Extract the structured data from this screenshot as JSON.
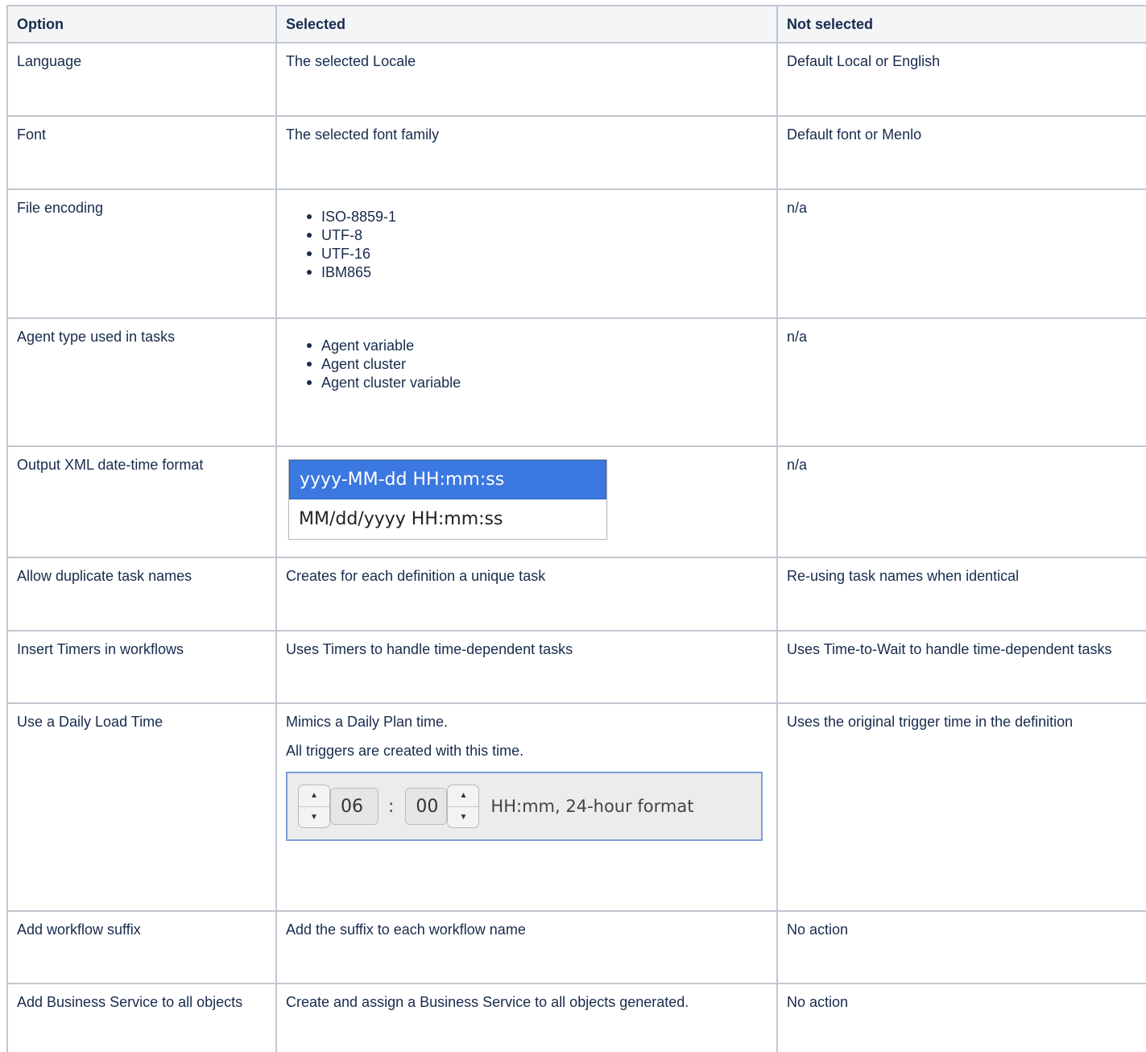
{
  "table": {
    "headers": [
      "Option",
      "Selected",
      "Not selected"
    ],
    "rows": [
      {
        "option": "Language",
        "selected": "The selected Locale",
        "not_selected": "Default Local or English"
      },
      {
        "option": "Font",
        "selected": "The selected font family",
        "not_selected": "Default font or Menlo"
      },
      {
        "option": "File encoding",
        "selected_list": [
          "ISO-8859-1",
          "UTF-8",
          "UTF-16",
          "IBM865"
        ],
        "not_selected": "n/a"
      },
      {
        "option": "Agent type used in tasks",
        "selected_list": [
          "Agent variable",
          "Agent cluster",
          "Agent cluster variable"
        ],
        "not_selected": "n/a"
      },
      {
        "option": "Output XML date-time format",
        "selected_formats": [
          "yyyy-MM-dd HH:mm:ss",
          "MM/dd/yyyy HH:mm:ss"
        ],
        "selected_format_active": "yyyy-MM-dd HH:mm:ss",
        "not_selected": "n/a"
      },
      {
        "option": "Allow duplicate task names",
        "selected": "Creates for each definition a unique task",
        "not_selected": "Re-using task names when identical"
      },
      {
        "option": "Insert Timers in workflows",
        "selected": "Uses Timers to handle time-dependent tasks",
        "not_selected": "Uses Time-to-Wait to handle time-dependent tasks"
      },
      {
        "option": "Use a Daily Load Time",
        "selected_p1": "Mimics a Daily Plan time.",
        "selected_p2": "All triggers are created with this time.",
        "time_widget": {
          "hours": "06",
          "separator": ":",
          "minutes": "00",
          "format_label": "HH:mm, 24-hour format",
          "icons": [
            "stepper-up-icon",
            "stepper-down-icon"
          ]
        },
        "not_selected": "Uses the original trigger time in the definition"
      },
      {
        "option": "Add workflow suffix",
        "selected": "Add the suffix to each workflow name",
        "not_selected": "No action"
      },
      {
        "option": "Add Business Service to all objects",
        "selected": "Create and assign a Business Service to all objects generated.",
        "not_selected": "No action"
      }
    ]
  },
  "colors": {
    "border": "#c1c7d0",
    "header_bg": "#f4f5f7",
    "text": "#172b4d",
    "selection": "#3b78e0"
  }
}
